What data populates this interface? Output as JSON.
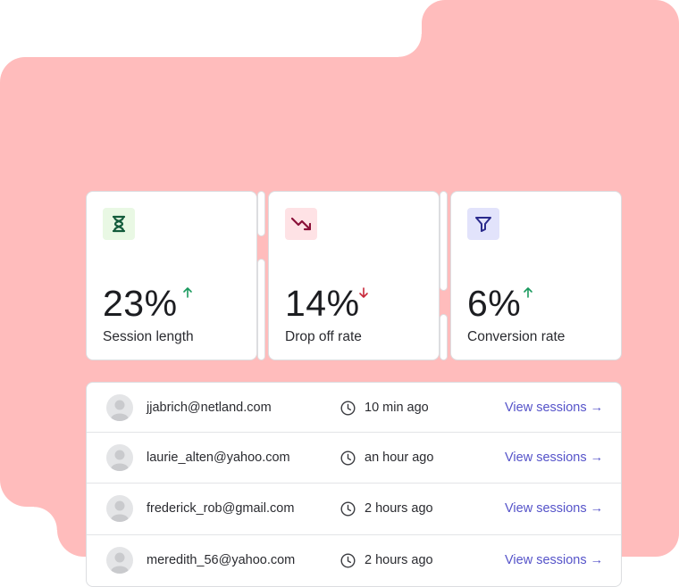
{
  "stats": [
    {
      "value": "23%",
      "trend": "up",
      "label": "Session length",
      "icon": "hourglass-icon",
      "icon_bg": "#e9f8e4",
      "icon_color": "#135b3b",
      "trend_color": "#1a9a5e"
    },
    {
      "value": "14%",
      "trend": "down",
      "label": "Drop off rate",
      "icon": "trending-down-icon",
      "icon_bg": "#fee2e5",
      "icon_color": "#8a1038",
      "trend_color": "#c8283a"
    },
    {
      "value": "6%",
      "trend": "up",
      "label": "Conversion rate",
      "icon": "funnel-icon",
      "icon_bg": "#e2e3fb",
      "icon_color": "#2a2a8c",
      "trend_color": "#1a9a5e"
    }
  ],
  "users": [
    {
      "email": "jjabrich@netland.com",
      "time": "10 min ago",
      "link": "View sessions →"
    },
    {
      "email": "laurie_alten@yahoo.com",
      "time": "an hour ago",
      "link": "View sessions →"
    },
    {
      "email": "frederick_rob@gmail.com",
      "time": "2 hours ago",
      "link": "View sessions →"
    },
    {
      "email": "meredith_56@yahoo.com",
      "time": "2 hours ago",
      "link": "View sessions →"
    }
  ],
  "colors": {
    "background_blob": "#ffbcbc",
    "link": "#5553c9"
  }
}
